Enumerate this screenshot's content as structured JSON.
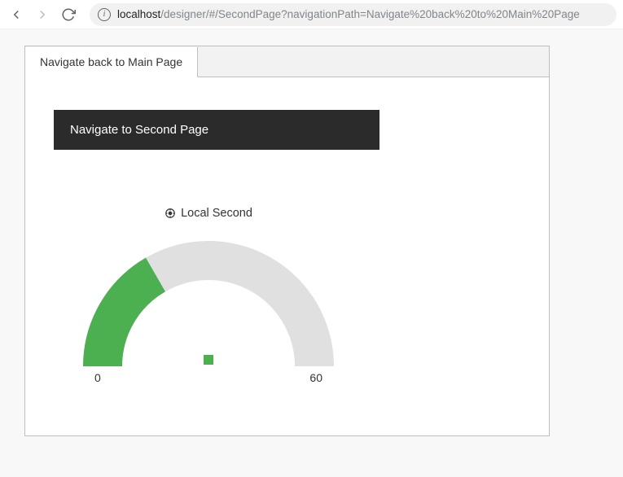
{
  "browser": {
    "url_host": "localhost",
    "url_path": "/designer/#/SecondPage?navigationPath=Navigate%20back%20to%20Main%20Page"
  },
  "tab": {
    "label": "Navigate back to Main Page"
  },
  "button": {
    "label": "Navigate to Second Page"
  },
  "gauge": {
    "title": "Local Second",
    "min_label": "0",
    "max_label": "60"
  },
  "colors": {
    "accent": "#4caf50",
    "track": "#e0e0e0",
    "button_bg": "#2b2b2b"
  },
  "chart_data": {
    "type": "gauge",
    "title": "Local Second",
    "min": 0,
    "max": 60,
    "value": 20,
    "series": [
      {
        "name": "Local Second",
        "color": "#4caf50"
      }
    ],
    "xlabel": "",
    "ylabel": "",
    "ylim": [
      0,
      60
    ]
  }
}
